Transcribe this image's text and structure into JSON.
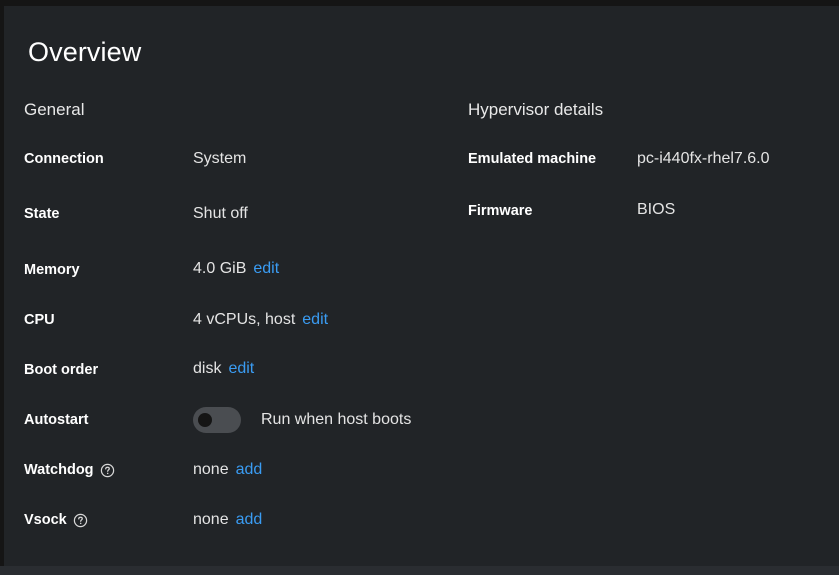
{
  "overview": {
    "title": "Overview",
    "general_heading": "General",
    "hypervisor_heading": "Hypervisor details"
  },
  "general": {
    "connection": {
      "label": "Connection",
      "value": "System"
    },
    "state": {
      "label": "State",
      "value": "Shut off"
    },
    "memory": {
      "label": "Memory",
      "value": "4.0 GiB",
      "action": "edit"
    },
    "cpu": {
      "label": "CPU",
      "value": "4 vCPUs, host",
      "action": "edit"
    },
    "boot_order": {
      "label": "Boot order",
      "value": "disk",
      "action": "edit"
    },
    "autostart": {
      "label": "Autostart",
      "toggle_text": "Run when host boots",
      "enabled": false
    },
    "watchdog": {
      "label": "Watchdog",
      "value": "none",
      "action": "add",
      "help_icon": "question-circle-icon"
    },
    "vsock": {
      "label": "Vsock",
      "value": "none",
      "action": "add",
      "help_icon": "question-circle-icon"
    }
  },
  "hypervisor": {
    "emulated_machine": {
      "label": "Emulated machine",
      "value": "pc-i440fx-rhel7.6.0"
    },
    "firmware": {
      "label": "Firmware",
      "value": "BIOS"
    }
  },
  "colors": {
    "background": "#151515",
    "card": "#212427",
    "link": "#3a9cf3",
    "toggle_off": "#4a4d51"
  }
}
